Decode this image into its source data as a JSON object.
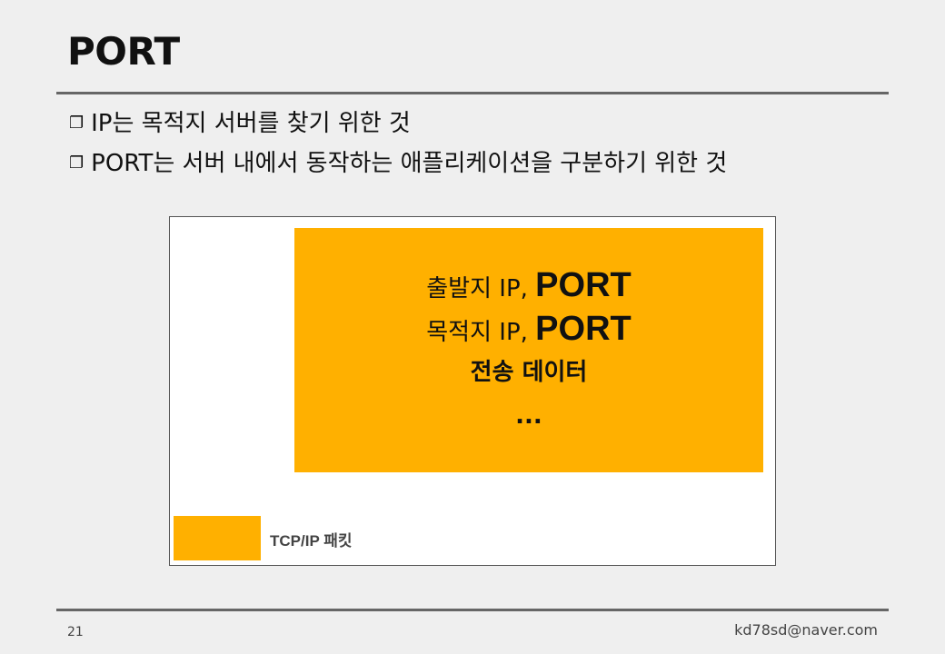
{
  "slide": {
    "title": "PORT",
    "bullets": [
      {
        "mark": "❐",
        "text": "IP는 목적지 서버를 찾기 위한 것"
      },
      {
        "mark": "❐",
        "text": "PORT는 서버 내에서 동작하는 애플리케이션을 구분하기 위한 것"
      }
    ]
  },
  "diagram": {
    "payload": {
      "line1_prefix": "출발지 IP, ",
      "line1_port": "PORT",
      "line2_prefix": "목적지 IP, ",
      "line2_port": "PORT",
      "line3": "전송 데이터",
      "line4": "..."
    },
    "legend_label": "TCP/IP 패킷",
    "packet_color": "#ffb000"
  },
  "footer": {
    "page_number": "21",
    "email": "kd78sd@naver.com"
  }
}
